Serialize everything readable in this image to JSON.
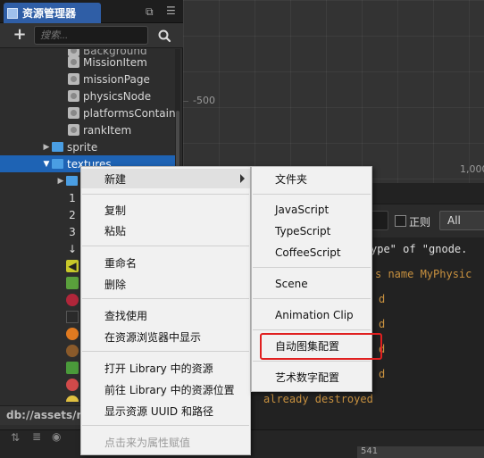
{
  "assets_panel": {
    "tab_title": "资源管理器",
    "search_placeholder": "搜索...",
    "add_label": "+",
    "path": "db://assets/res",
    "tree": [
      {
        "label": "MissionItem",
        "type": "prefab"
      },
      {
        "label": "missionPage",
        "type": "prefab"
      },
      {
        "label": "physicsNode",
        "type": "prefab"
      },
      {
        "label": "platformsContaine",
        "type": "prefab"
      },
      {
        "label": "rankItem",
        "type": "prefab"
      },
      {
        "label": "sprite",
        "type": "folder",
        "expanded": false
      },
      {
        "label": "textures",
        "type": "folder",
        "expanded": true,
        "selected": true
      }
    ],
    "children_glyphs": [
      "1",
      "2",
      "3",
      "↓"
    ]
  },
  "scene": {
    "axis_label_left": "-500",
    "axis_label_right": "1,000"
  },
  "console": {
    "regex_label": "正则",
    "level_value": "All",
    "lines": [
      {
        "text": "ype\" of \"gnode.",
        "color": "white"
      },
      {
        "text": "s name MyPhysic",
        "color": "orange"
      },
      {
        "text": "d",
        "color": "orange"
      },
      {
        "text": "d",
        "color": "orange"
      },
      {
        "text": "d",
        "color": "orange"
      },
      {
        "text": "d",
        "color": "orange"
      },
      {
        "text": "already destroyed",
        "color": "orange"
      }
    ]
  },
  "status_bar": {
    "right_text": "541"
  },
  "context_menu": {
    "items": [
      {
        "label": "新建",
        "has_submenu": true
      },
      {
        "label": "复制"
      },
      {
        "label": "粘贴"
      },
      {
        "label": "重命名"
      },
      {
        "label": "删除"
      },
      {
        "label": "查找使用"
      },
      {
        "label": "在资源浏览器中显示"
      },
      {
        "label": "打开 Library 中的资源"
      },
      {
        "label": "前往 Library 中的资源位置"
      },
      {
        "label": "显示资源 UUID 和路径"
      },
      {
        "label": "点击来为属性赋值",
        "disabled": true
      }
    ]
  },
  "submenu": {
    "items": [
      {
        "label": "文件夹"
      },
      {
        "label": "JavaScript"
      },
      {
        "label": "TypeScript"
      },
      {
        "label": "CoffeeScript"
      },
      {
        "label": "Scene"
      },
      {
        "label": "Animation Clip"
      },
      {
        "label": "自动图集配置",
        "highlighted": true
      },
      {
        "label": "艺术数字配置"
      }
    ]
  },
  "colors": {
    "selection": "#1e63b4",
    "tab_active": "#2f5ea6",
    "highlight_border": "#e02020",
    "log_orange": "#c8913f"
  }
}
